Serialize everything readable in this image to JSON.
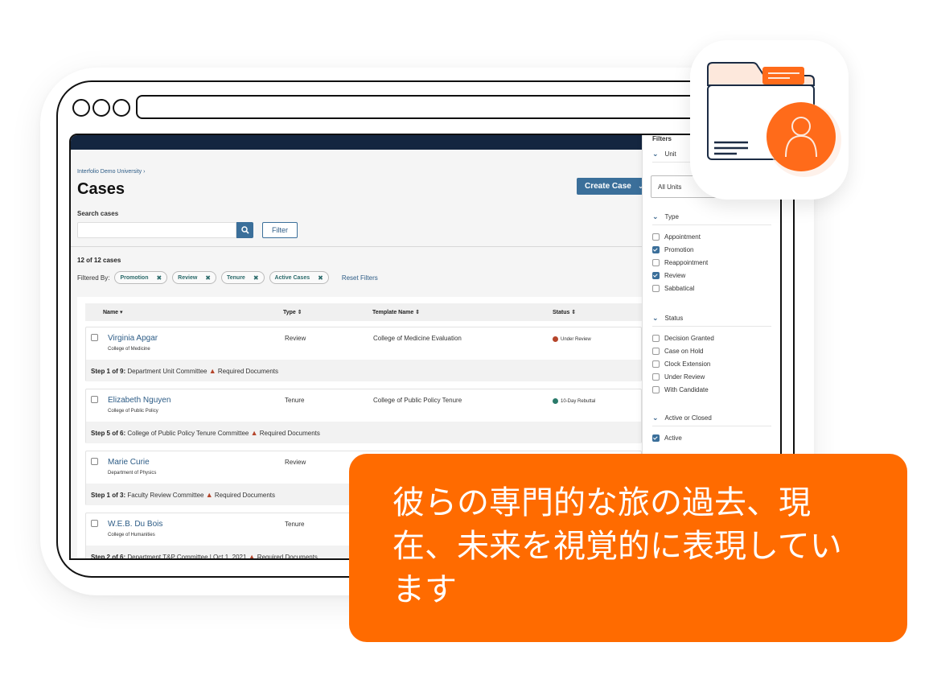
{
  "breadcrumb": "Interfolio Demo University  ›",
  "page_title": "Cases",
  "create_case_label": "Create Case",
  "search": {
    "label": "Search cases",
    "value": "",
    "placeholder": ""
  },
  "filter_button": "Filter",
  "case_count": "12 of 12 cases",
  "filtered_by_label": "Filtered By:",
  "filter_chips": [
    {
      "label": "Promotion"
    },
    {
      "label": "Review"
    },
    {
      "label": "Tenure"
    },
    {
      "label": "Active Cases"
    }
  ],
  "reset_filters": "Reset Filters",
  "columns": {
    "name": "Name",
    "type": "Type",
    "template": "Template Name",
    "status": "Status"
  },
  "cases": [
    {
      "name": "Virginia Apgar",
      "unit": "College of Medicine",
      "type": "Review",
      "template": "College of Medicine Evaluation",
      "status": "Under Review",
      "status_color": "#b5452b",
      "step_label": "Step 1 of 9:",
      "step_text": " Department Unit Committee ",
      "date": "",
      "docs": " Required Documents"
    },
    {
      "name": "Elizabeth Nguyen",
      "unit": "College of Public Policy",
      "type": "Tenure",
      "template": "College of Public Policy Tenure",
      "status": "10-Day Rebuttal",
      "status_color": "#2a7a6a",
      "step_label": "Step 5 of 6:",
      "step_text": " College of Public Policy Tenure Committee ",
      "date": "",
      "docs": " Required Documents"
    },
    {
      "name": "Marie Curie",
      "unit": "Department of Physics",
      "type": "Review",
      "template": "",
      "status": "",
      "status_color": "",
      "step_label": "Step 1 of 3:",
      "step_text": " Faculty Review Committee ",
      "date": "",
      "docs": " Required Documents"
    },
    {
      "name": "W.E.B. Du Bois",
      "unit": "College of Humanities",
      "type": "Tenure",
      "template": "",
      "status": "",
      "status_color": "",
      "step_label": "Step 2 of 6:",
      "step_text": " Department T&P Committee |  Oct 1, 2021 ",
      "date": "",
      "docs": " Required Documents"
    }
  ],
  "filters_panel": {
    "title": "Filters",
    "unit": {
      "label": "Unit",
      "selected": "All Units"
    },
    "type": {
      "label": "Type",
      "options": [
        {
          "label": "Appointment",
          "checked": false
        },
        {
          "label": "Promotion",
          "checked": true
        },
        {
          "label": "Reappointment",
          "checked": false
        },
        {
          "label": "Review",
          "checked": true
        },
        {
          "label": "Sabbatical",
          "checked": false
        }
      ]
    },
    "status": {
      "label": "Status",
      "options": [
        {
          "label": "Decision Granted",
          "checked": false
        },
        {
          "label": "Case on Hold",
          "checked": false
        },
        {
          "label": "Clock Extension",
          "checked": false
        },
        {
          "label": "Under Review",
          "checked": false
        },
        {
          "label": "With Candidate",
          "checked": false
        }
      ]
    },
    "active_closed": {
      "label": "Active or Closed",
      "options": [
        {
          "label": "Active",
          "checked": true
        }
      ]
    }
  },
  "callout_text": "彼らの専門的な旅の過去、現在、未来を視覚的に表現しています",
  "colors": {
    "accent_orange": "#ff6b00",
    "primary_blue": "#3b6f9a",
    "nav_dark": "#142640"
  }
}
